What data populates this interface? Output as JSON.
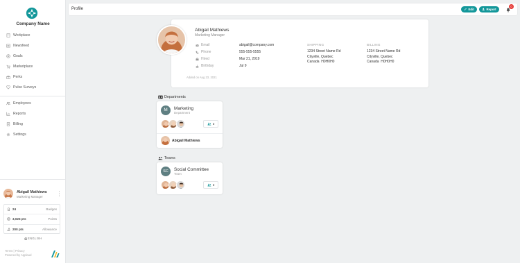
{
  "app": {
    "company_name": "Company Name",
    "brand_color": "#13979a"
  },
  "sidebar": {
    "nav_primary": [
      {
        "label": "Workplace",
        "icon": "workplace-icon"
      },
      {
        "label": "Newsfeed",
        "icon": "newsfeed-icon"
      },
      {
        "label": "Goals",
        "icon": "goals-icon"
      },
      {
        "label": "Marketplace",
        "icon": "marketplace-icon"
      },
      {
        "label": "Perks",
        "icon": "perks-icon"
      },
      {
        "label": "Pulse Surveys",
        "icon": "pulse-icon"
      }
    ],
    "nav_secondary": [
      {
        "label": "Employees",
        "icon": "employees-icon"
      },
      {
        "label": "Reports",
        "icon": "reports-icon"
      },
      {
        "label": "Billing",
        "icon": "billing-icon"
      },
      {
        "label": "Settings",
        "icon": "settings-icon"
      }
    ],
    "user": {
      "name": "Abigail Mathiews",
      "role": "Marketing Manager"
    },
    "stats": [
      {
        "value": "24",
        "label": "Badges",
        "icon": "badge-icon"
      },
      {
        "value": "3,025 pts",
        "label": "Points",
        "icon": "points-icon"
      },
      {
        "value": "200 pts",
        "label": "Allowance",
        "icon": "allowance-icon"
      }
    ],
    "language": "ENGLISH",
    "footer": {
      "links": "Terms | Privacy",
      "powered": "Powered by Applaud"
    }
  },
  "header": {
    "title": "Profile",
    "edit_label": "Edit",
    "report_label": "Report",
    "notification_count": "0"
  },
  "profile": {
    "name": "Abigail Mathiews",
    "role": "Marketing Manager",
    "fields": {
      "email_label": "Email",
      "email": "abigail@company.com",
      "phone_label": "Phone",
      "phone": "555-555-5555",
      "hired_label": "Hired",
      "hired": "Mar 21, 2019",
      "birthday_label": "Birthday",
      "birthday": "Jul 9"
    },
    "shipping": {
      "heading": "SHIPPING",
      "line1": "1234 Street Name Rd",
      "line2": "Cityville, Quebec",
      "line3": "Canada  H0H0H0"
    },
    "billing": {
      "heading": "BILLING",
      "line1": "1234 Street Name Rd",
      "line2": "Cityville, Quebec",
      "line3": "Canada  H0H0H0"
    },
    "added": "Added on Aug 23, 2021"
  },
  "departments": {
    "title": "Departments",
    "card": {
      "initial": "M",
      "name": "Marketing",
      "type": "Department",
      "member_count": "3",
      "lead": "Abigail Mathiews",
      "color": "#5f7f82"
    }
  },
  "teams": {
    "title": "Teams",
    "card": {
      "initial": "SC",
      "name": "Social Committee",
      "type": "Team",
      "member_count": "3",
      "color": "#5f7f82"
    }
  }
}
